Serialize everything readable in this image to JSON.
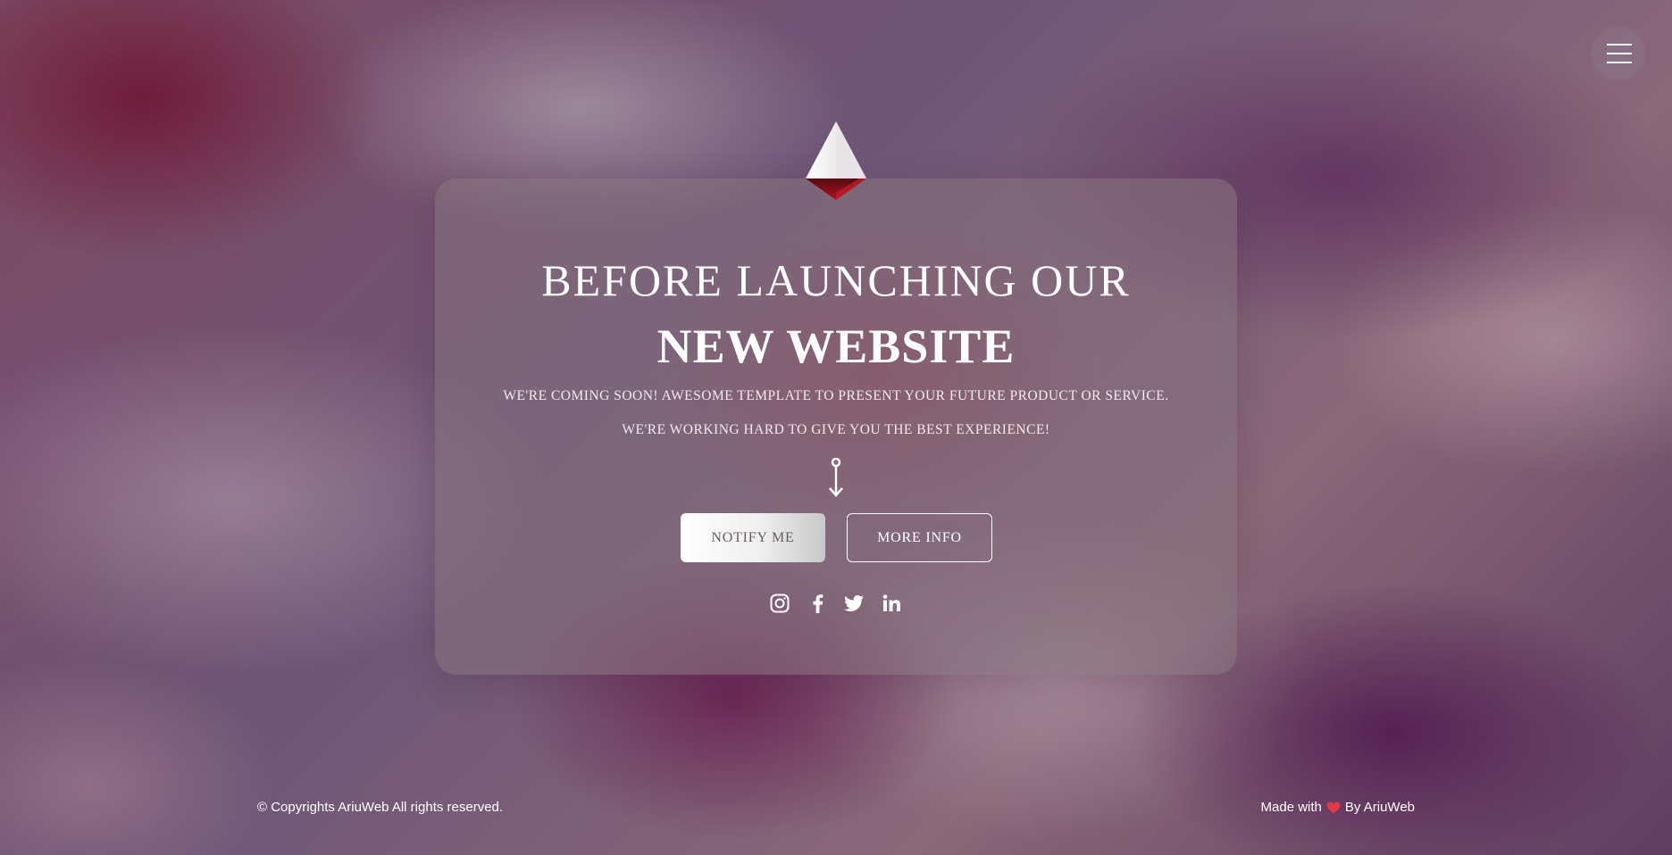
{
  "menu": {
    "icon": "hamburger-menu-icon"
  },
  "logo": {
    "icon": "diamond-pyramid-logo"
  },
  "hero": {
    "heading_line1": "BEFORE LAUNCHING OUR",
    "heading_line2": "NEW WEBSITE",
    "subtext_line1": "WE'RE COMING SOON! AWESOME TEMPLATE TO PRESENT YOUR FUTURE PRODUCT OR SERVICE.",
    "subtext_line2": "WE'RE WORKING HARD TO GIVE YOU THE BEST EXPERIENCE!",
    "scroll_icon": "scroll-down-arrow-icon"
  },
  "buttons": {
    "notify_label": "NOTIFY ME",
    "more_info_label": "MORE INFO"
  },
  "social": [
    {
      "icon": "instagram-icon"
    },
    {
      "icon": "facebook-icon"
    },
    {
      "icon": "twitter-icon"
    },
    {
      "icon": "linkedin-icon"
    }
  ],
  "footer": {
    "copyright": "© Copyrights AriuWeb All rights reserved.",
    "made_with_prefix": "Made with",
    "made_with_suffix": "By AriuWeb",
    "heart_icon": "heart-icon"
  },
  "colors": {
    "text": "#ffffff",
    "heart": "#e03a4a",
    "logo_accent": "#8e0f1a"
  }
}
